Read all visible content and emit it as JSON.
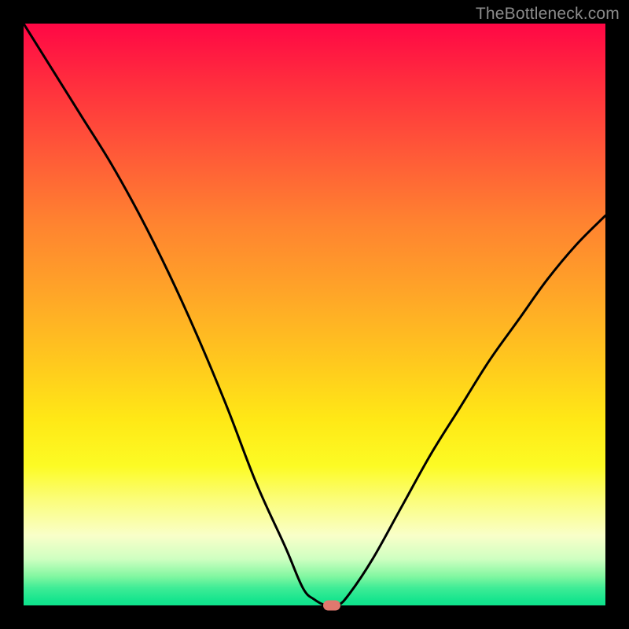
{
  "watermark": "TheBottleneck.com",
  "colors": {
    "frame": "#000000",
    "curve": "#000000",
    "marker": "#e0786e"
  },
  "chart_data": {
    "type": "line",
    "title": "",
    "xlabel": "",
    "ylabel": "",
    "xlim": [
      0,
      100
    ],
    "ylim": [
      0,
      100
    ],
    "grid": false,
    "legend": false,
    "annotations": [
      "TheBottleneck.com"
    ],
    "series": [
      {
        "name": "bottleneck-curve",
        "x": [
          0,
          5,
          10,
          15,
          20,
          25,
          30,
          35,
          40,
          45,
          48,
          50,
          52,
          54,
          56,
          60,
          65,
          70,
          75,
          80,
          85,
          90,
          95,
          100
        ],
        "values": [
          100,
          92,
          84,
          76,
          67,
          57,
          46,
          34,
          21,
          10,
          3,
          1,
          0,
          0,
          2,
          8,
          17,
          26,
          34,
          42,
          49,
          56,
          62,
          67
        ]
      }
    ],
    "marker": {
      "x": 53,
      "y": 0
    },
    "background_gradient": {
      "type": "vertical",
      "stops": [
        {
          "pos": 0.0,
          "color": "#ff0745"
        },
        {
          "pos": 0.5,
          "color": "#ffb024"
        },
        {
          "pos": 0.78,
          "color": "#fbfd50"
        },
        {
          "pos": 1.0,
          "color": "#10e28c"
        }
      ]
    }
  }
}
